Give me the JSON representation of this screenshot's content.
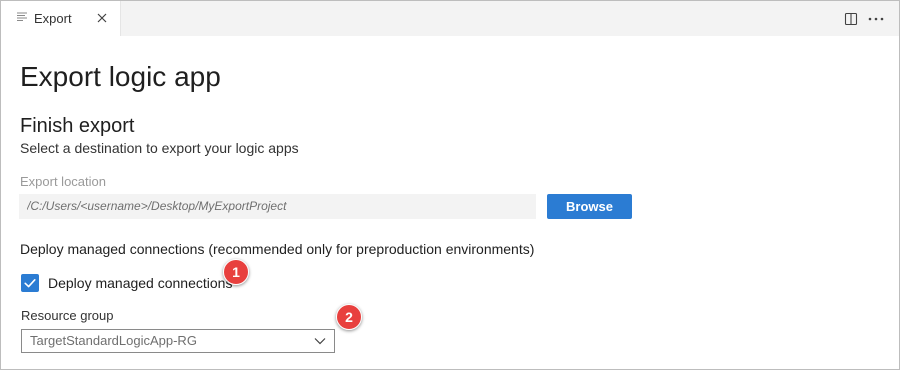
{
  "tab": {
    "label": "Export",
    "icon": "document-lines-icon",
    "close_icon": "close-icon"
  },
  "toolbar": {
    "split_icon": "split-editor-icon",
    "more_icon": "more-actions-icon"
  },
  "page": {
    "title": "Export logic app"
  },
  "finish_export": {
    "title": "Finish export",
    "description": "Select a destination to export your logic apps",
    "location_label": "Export location",
    "location_value": "/C:/Users/<username>/Desktop/MyExportProject",
    "browse_label": "Browse"
  },
  "deploy": {
    "heading": "Deploy managed connections (recommended only for preproduction environments)",
    "checkbox_label": "Deploy managed connections",
    "checkbox_checked": true
  },
  "resource_group": {
    "label": "Resource group",
    "selected": "TargetStandardLogicApp-RG"
  },
  "annotations": {
    "badge_1": "1",
    "badge_2": "2"
  },
  "colors": {
    "accent": "#2b7cd3",
    "badge": "#e8403e",
    "tabbar": "#f3f3f3"
  }
}
